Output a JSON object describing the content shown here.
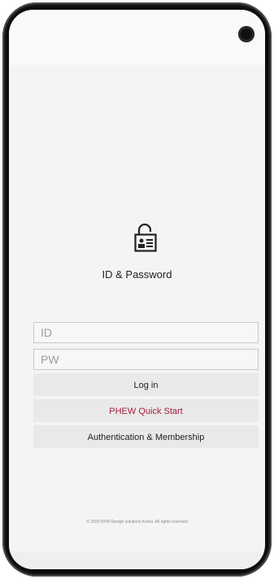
{
  "login": {
    "title": "ID & Password",
    "id_placeholder": "ID",
    "pw_placeholder": "PW",
    "login_button": "Log in",
    "quick_start_button": "PHEW Quick Start",
    "auth_button": "Authentication & Membership"
  },
  "footer": {
    "copyright": "© 2020 KKW Design solutions Korea. All rights reserved"
  },
  "icons": {
    "logo": "unlocked-id-card-icon",
    "camera": "front-camera"
  },
  "colors": {
    "accent": "#a5203e",
    "button_bg": "#e9e9e9",
    "screen_bg": "#f4f4f4"
  }
}
